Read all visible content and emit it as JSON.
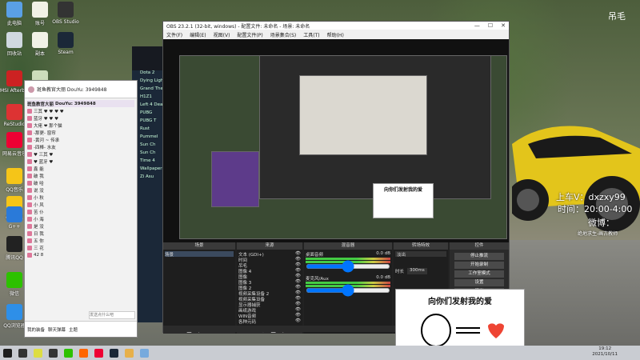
{
  "desktop": {
    "icons": [
      {
        "label": "此电脑",
        "color": "#5aa0e6"
      },
      {
        "label": "账号",
        "color": "#f1f1e6"
      },
      {
        "label": "OBS Studio",
        "color": "#333"
      },
      {
        "label": "回收站",
        "color": "#d0d8e0"
      },
      {
        "label": "副本",
        "color": "#f1f1e6"
      },
      {
        "label": "Steam",
        "color": "#1b2838"
      },
      {
        "label": "MSI Afterburner",
        "color": "#c22"
      },
      {
        "label": "网络",
        "color": "#cdb"
      },
      {
        "label": "ReStudio",
        "color": "#d33"
      },
      {
        "label": "网易云音乐",
        "color": "#e03"
      },
      {
        "label": "QQ音乐",
        "color": "#f5c518"
      },
      {
        "label": "QQ音乐",
        "color": "#f5c518"
      },
      {
        "label": "G++",
        "color": "#2a7ad9"
      },
      {
        "label": "腾讯QQ",
        "color": "#222"
      },
      {
        "label": "微信",
        "color": "#2dc100"
      },
      {
        "label": "QQ浏览器",
        "color": "#2e8fe8"
      }
    ],
    "watermark": "吊毛",
    "overlay_qq": "上车V：dxzxy99",
    "overlay_time": "时间：20:00-4:00",
    "overlay_weibo": "微博：",
    "overlay_weibo_name": "绝地求生-画古教师"
  },
  "chat": {
    "title": "斑鱼教官大丽 DouYu: 3949848",
    "header_name": "斑鱼教官大丽",
    "header_id": "DouYu: 3949848",
    "rows": [
      "三其 ♥ ♥ ♥ ♥",
      "蓝牙 ♥ ♥ ♥",
      "大佬 ❤ 那个猫",
      "-那更- 窗帘",
      "-黄河 ~ 传承",
      "-四棒- 水友",
      "♥ 三其 ♥",
      "♥ 蓝牙 ♥",
      "鑫 能",
      "破 我",
      "破 哈",
      "说 没",
      "小 秋",
      "小 风",
      "苦 仆",
      "小 海",
      "是 没",
      "日 我",
      "五 你",
      "三 花",
      "42 8"
    ],
    "bottom_items": [
      "我的装备",
      "聊天弹幕",
      "主题"
    ],
    "input_placeholder": "发送点什么吧"
  },
  "browser": {
    "items": [
      "Dota 2",
      "Dying Light",
      "Grand Theft",
      "H1Z1",
      "Left 4 Dead",
      "PUBG",
      "PUBG T",
      "Rust",
      "Pummel",
      "Sun Ch",
      "Sun Ch",
      "Time 4",
      "Wallpaper",
      "Zi Asu"
    ]
  },
  "obs": {
    "title": "OBS 23.2.1 (32-bit, windows) - 配置文件: 未命名 - 场景: 未命名",
    "menu": [
      "文件(F)",
      "编辑(E)",
      "视图(V)",
      "配置文件(P)",
      "场景集合(S)",
      "工具(T)",
      "帮助(H)"
    ],
    "docks": {
      "scenes": {
        "header": "场景",
        "items": [
          "场景"
        ]
      },
      "sources": {
        "header": "来源",
        "items": [
          "文本 (GDI+)",
          "时间",
          "吊毛",
          "图像 4",
          "图像",
          "图像 3",
          "图像 2",
          "视频采集设备 2",
          "视频采集设备",
          "显示器捕获",
          "画纸游戏",
          "WIN音频",
          "各种元码"
        ]
      },
      "mixer": {
        "header": "混音器",
        "rows": [
          {
            "name": "桌面音频",
            "db": "0.0 dB"
          },
          {
            "name": "麦克风/Aux",
            "db": "0.0 dB"
          }
        ]
      },
      "transitions": {
        "header": "转场特效",
        "type": "淡出",
        "duration_label": "时长",
        "duration": "300ms"
      },
      "controls": {
        "header": "控件",
        "buttons": [
          "停止推流",
          "开始录制",
          "工作室模式",
          "设置",
          "退出"
        ]
      }
    },
    "status": "LIVE: 00:00:00   REC: 00:00:00   CPU: 12%, 30.00 fps"
  },
  "memes": [
    {
      "caption": "向你们发射我的爱"
    },
    {
      "caption": "向你们发射我的爱"
    }
  ],
  "taskbar": {
    "icons": [
      {
        "name": "start",
        "color": "#1e1e1e"
      },
      {
        "name": "search",
        "color": "#333"
      },
      {
        "name": "chrome",
        "color": "#dd4"
      },
      {
        "name": "obs",
        "color": "#333"
      },
      {
        "name": "wechat",
        "color": "#2dc100"
      },
      {
        "name": "douyu",
        "color": "#f60"
      },
      {
        "name": "netease",
        "color": "#e03"
      },
      {
        "name": "steam",
        "color": "#1b2838"
      },
      {
        "name": "folder",
        "color": "#e7b04a"
      },
      {
        "name": "note",
        "color": "#7ad"
      }
    ],
    "time": "19:12",
    "date": "2021/10/11"
  }
}
